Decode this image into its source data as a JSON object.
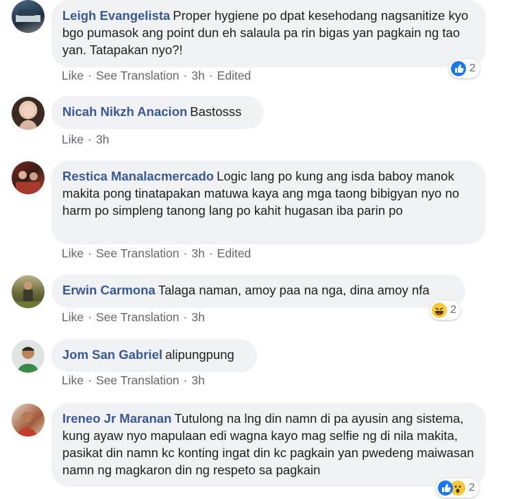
{
  "comments": [
    {
      "author": "Leigh Evangelista",
      "text": "Proper hygiene po dpat kesehodang nagsanitize kyo bgo pumasok ang point dun eh salaula pa rin bigas yan pagkain ng tao yan. Tatapakan nyo?!",
      "actions": [
        "Like",
        "See Translation",
        "3h",
        "Edited"
      ],
      "reactions": {
        "icons": [
          "like-icon"
        ],
        "count": "2"
      }
    },
    {
      "author": "Nicah Nikzh Anacion",
      "text": "Bastosss",
      "actions": [
        "Like",
        "3h"
      ]
    },
    {
      "author": "Restica Manalacmercado",
      "text": "Logic lang po kung ang isda baboy manok makita pong tinatapakan matuwa kaya ang mga taong bibigyan nyo no harm po simpleng tanong lang po kahit hugasan iba parin po",
      "actions": [
        "Like",
        "See Translation",
        "3h",
        "Edited"
      ]
    },
    {
      "author": "Erwin Carmona",
      "text": "Talaga naman, amoy paa na nga, dina amoy nfa",
      "actions": [
        "Like",
        "See Translation",
        "3h"
      ],
      "reactions": {
        "icons": [
          "haha-icon"
        ],
        "count": "2"
      }
    },
    {
      "author": "Jom San Gabriel",
      "text": "alipungpung",
      "actions": [
        "Like",
        "See Translation",
        "3h"
      ]
    },
    {
      "author": "Ireneo Jr Maranan",
      "text": "Tutulong na lng din namn di pa ayusin ang sistema, kung ayaw nyo mapulaan edi wagna kayo mag selfie ng di nila makita, pasikat din namn kc konting ingat din kc pagkain yan pwedeng maiwasan namn ng magkaron din ng respeto sa pagkain",
      "reactions": {
        "icons": [
          "like-icon",
          "wow-icon"
        ],
        "count": "2"
      }
    }
  ],
  "colors": {
    "author": "#385898",
    "bubble": "#f0f2f5",
    "meta": "#65676b",
    "like": "#1877f2"
  }
}
